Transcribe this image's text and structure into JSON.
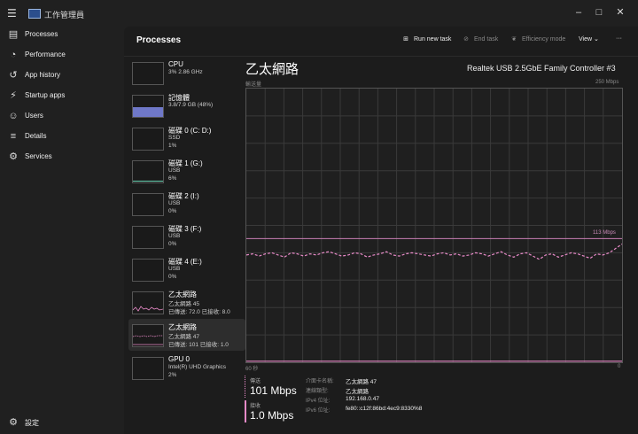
{
  "window": {
    "title": "工作管理員",
    "minimize": "–",
    "maximize": "□",
    "close": "✕"
  },
  "sidebar": {
    "items": [
      {
        "label": "Processes",
        "icon": "processes-icon"
      },
      {
        "label": "Performance",
        "icon": "performance-icon"
      },
      {
        "label": "App history",
        "icon": "history-icon"
      },
      {
        "label": "Startup apps",
        "icon": "startup-icon"
      },
      {
        "label": "Users",
        "icon": "users-icon"
      },
      {
        "label": "Details",
        "icon": "details-icon"
      },
      {
        "label": "Services",
        "icon": "services-icon"
      }
    ],
    "settings_label": "設定"
  },
  "header": {
    "title": "Processes",
    "run_new_task": "Run new task",
    "end_task": "End task",
    "efficiency_mode": "Efficiency mode",
    "view": "View"
  },
  "devices": [
    {
      "name": "CPU",
      "sub1": "3%  2.86 GHz",
      "sub2": ""
    },
    {
      "name": "記憶體",
      "sub1": "3.8/7.9 GB (48%)",
      "sub2": ""
    },
    {
      "name": "磁碟 0 (C: D:)",
      "sub1": "SSD",
      "sub2": "1%"
    },
    {
      "name": "磁碟 1 (G:)",
      "sub1": "USB",
      "sub2": "6%"
    },
    {
      "name": "磁碟 2 (I:)",
      "sub1": "USB",
      "sub2": "0%"
    },
    {
      "name": "磁碟 3 (F:)",
      "sub1": "USB",
      "sub2": "0%"
    },
    {
      "name": "磁碟 4 (E:)",
      "sub1": "USB",
      "sub2": "0%"
    },
    {
      "name": "乙太網路",
      "sub1": "乙太網路 45",
      "sub2": "已傳送: 72.0 已接收: 8.0"
    },
    {
      "name": "乙太網路",
      "sub1": "乙太網路 47",
      "sub2": "已傳送: 101 已接收: 1.0"
    },
    {
      "name": "GPU 0",
      "sub1": "Intel(R) UHD Graphics",
      "sub2": "2%"
    }
  ],
  "detail": {
    "title": "乙太網路",
    "adapter": "Realtek USB 2.5GbE Family Controller #3",
    "throughput_label": "輸送量",
    "max_label": "250 Mbps",
    "line_label": "113 Mbps",
    "time_label": "60 秒",
    "zero_label": "0",
    "send_label": "傳送",
    "send_value": "101 Mbps",
    "recv_label": "接收",
    "recv_value": "1.0 Mbps",
    "meta": [
      {
        "label": "介面卡名稱:",
        "value": "乙太網路 47"
      },
      {
        "label": "連線類型:",
        "value": "乙太網路"
      },
      {
        "label": "IPv4 位址:",
        "value": "192.168.0.47"
      },
      {
        "label": "IPv6 位址:",
        "value": "fe80::c12f:86bd:4ec9:8330%8"
      }
    ]
  },
  "chart_data": {
    "type": "line",
    "ylim": [
      0,
      250
    ],
    "xlabel": "60 秒",
    "ylabel": "輸送量",
    "series": [
      {
        "values": [
          98,
          99,
          97,
          99,
          100,
          98,
          96,
          100,
          99,
          97,
          99,
          98,
          100,
          101,
          99,
          97,
          98,
          100,
          99,
          96,
          98,
          99,
          101,
          98,
          97,
          99,
          100,
          99,
          98,
          97,
          99,
          100,
          98,
          99,
          97,
          98,
          100,
          99,
          97,
          99,
          101,
          98,
          96,
          99,
          100,
          97,
          94,
          98,
          99,
          96,
          98,
          100,
          99,
          97,
          95,
          99,
          98,
          100,
          104,
          108
        ],
        "color": "#e88ac8"
      },
      {
        "values": [
          1,
          1,
          1,
          1,
          1,
          1,
          1,
          1,
          1,
          1,
          1,
          1,
          1,
          1,
          1,
          1,
          1,
          1,
          1,
          1,
          1,
          1,
          1,
          1,
          1,
          1,
          1,
          1,
          1,
          1,
          1,
          1,
          1,
          1,
          1,
          1,
          1,
          1,
          1,
          1,
          1,
          1,
          1,
          1,
          1,
          1,
          1,
          1,
          1,
          1,
          1,
          1,
          1,
          1,
          1,
          1,
          1,
          1,
          1,
          1
        ],
        "color": "#e88ac8"
      }
    ],
    "reference_line": 113
  }
}
